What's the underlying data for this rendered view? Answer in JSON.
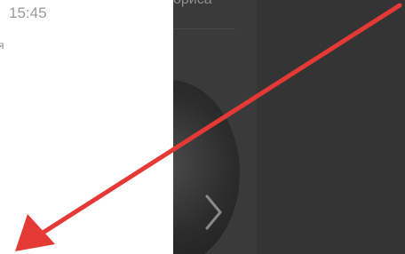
{
  "left_panel": {
    "time": "15:45",
    "subtitle": "я"
  },
  "right_panel": {
    "title": "ориса"
  },
  "media": {
    "next_icon": "chevron-right-icon"
  },
  "annotation": {
    "arrow_color": "#e53935"
  },
  "colors": {
    "dark_panel": "#3a3a3a",
    "left_panel": "#ffffff"
  }
}
